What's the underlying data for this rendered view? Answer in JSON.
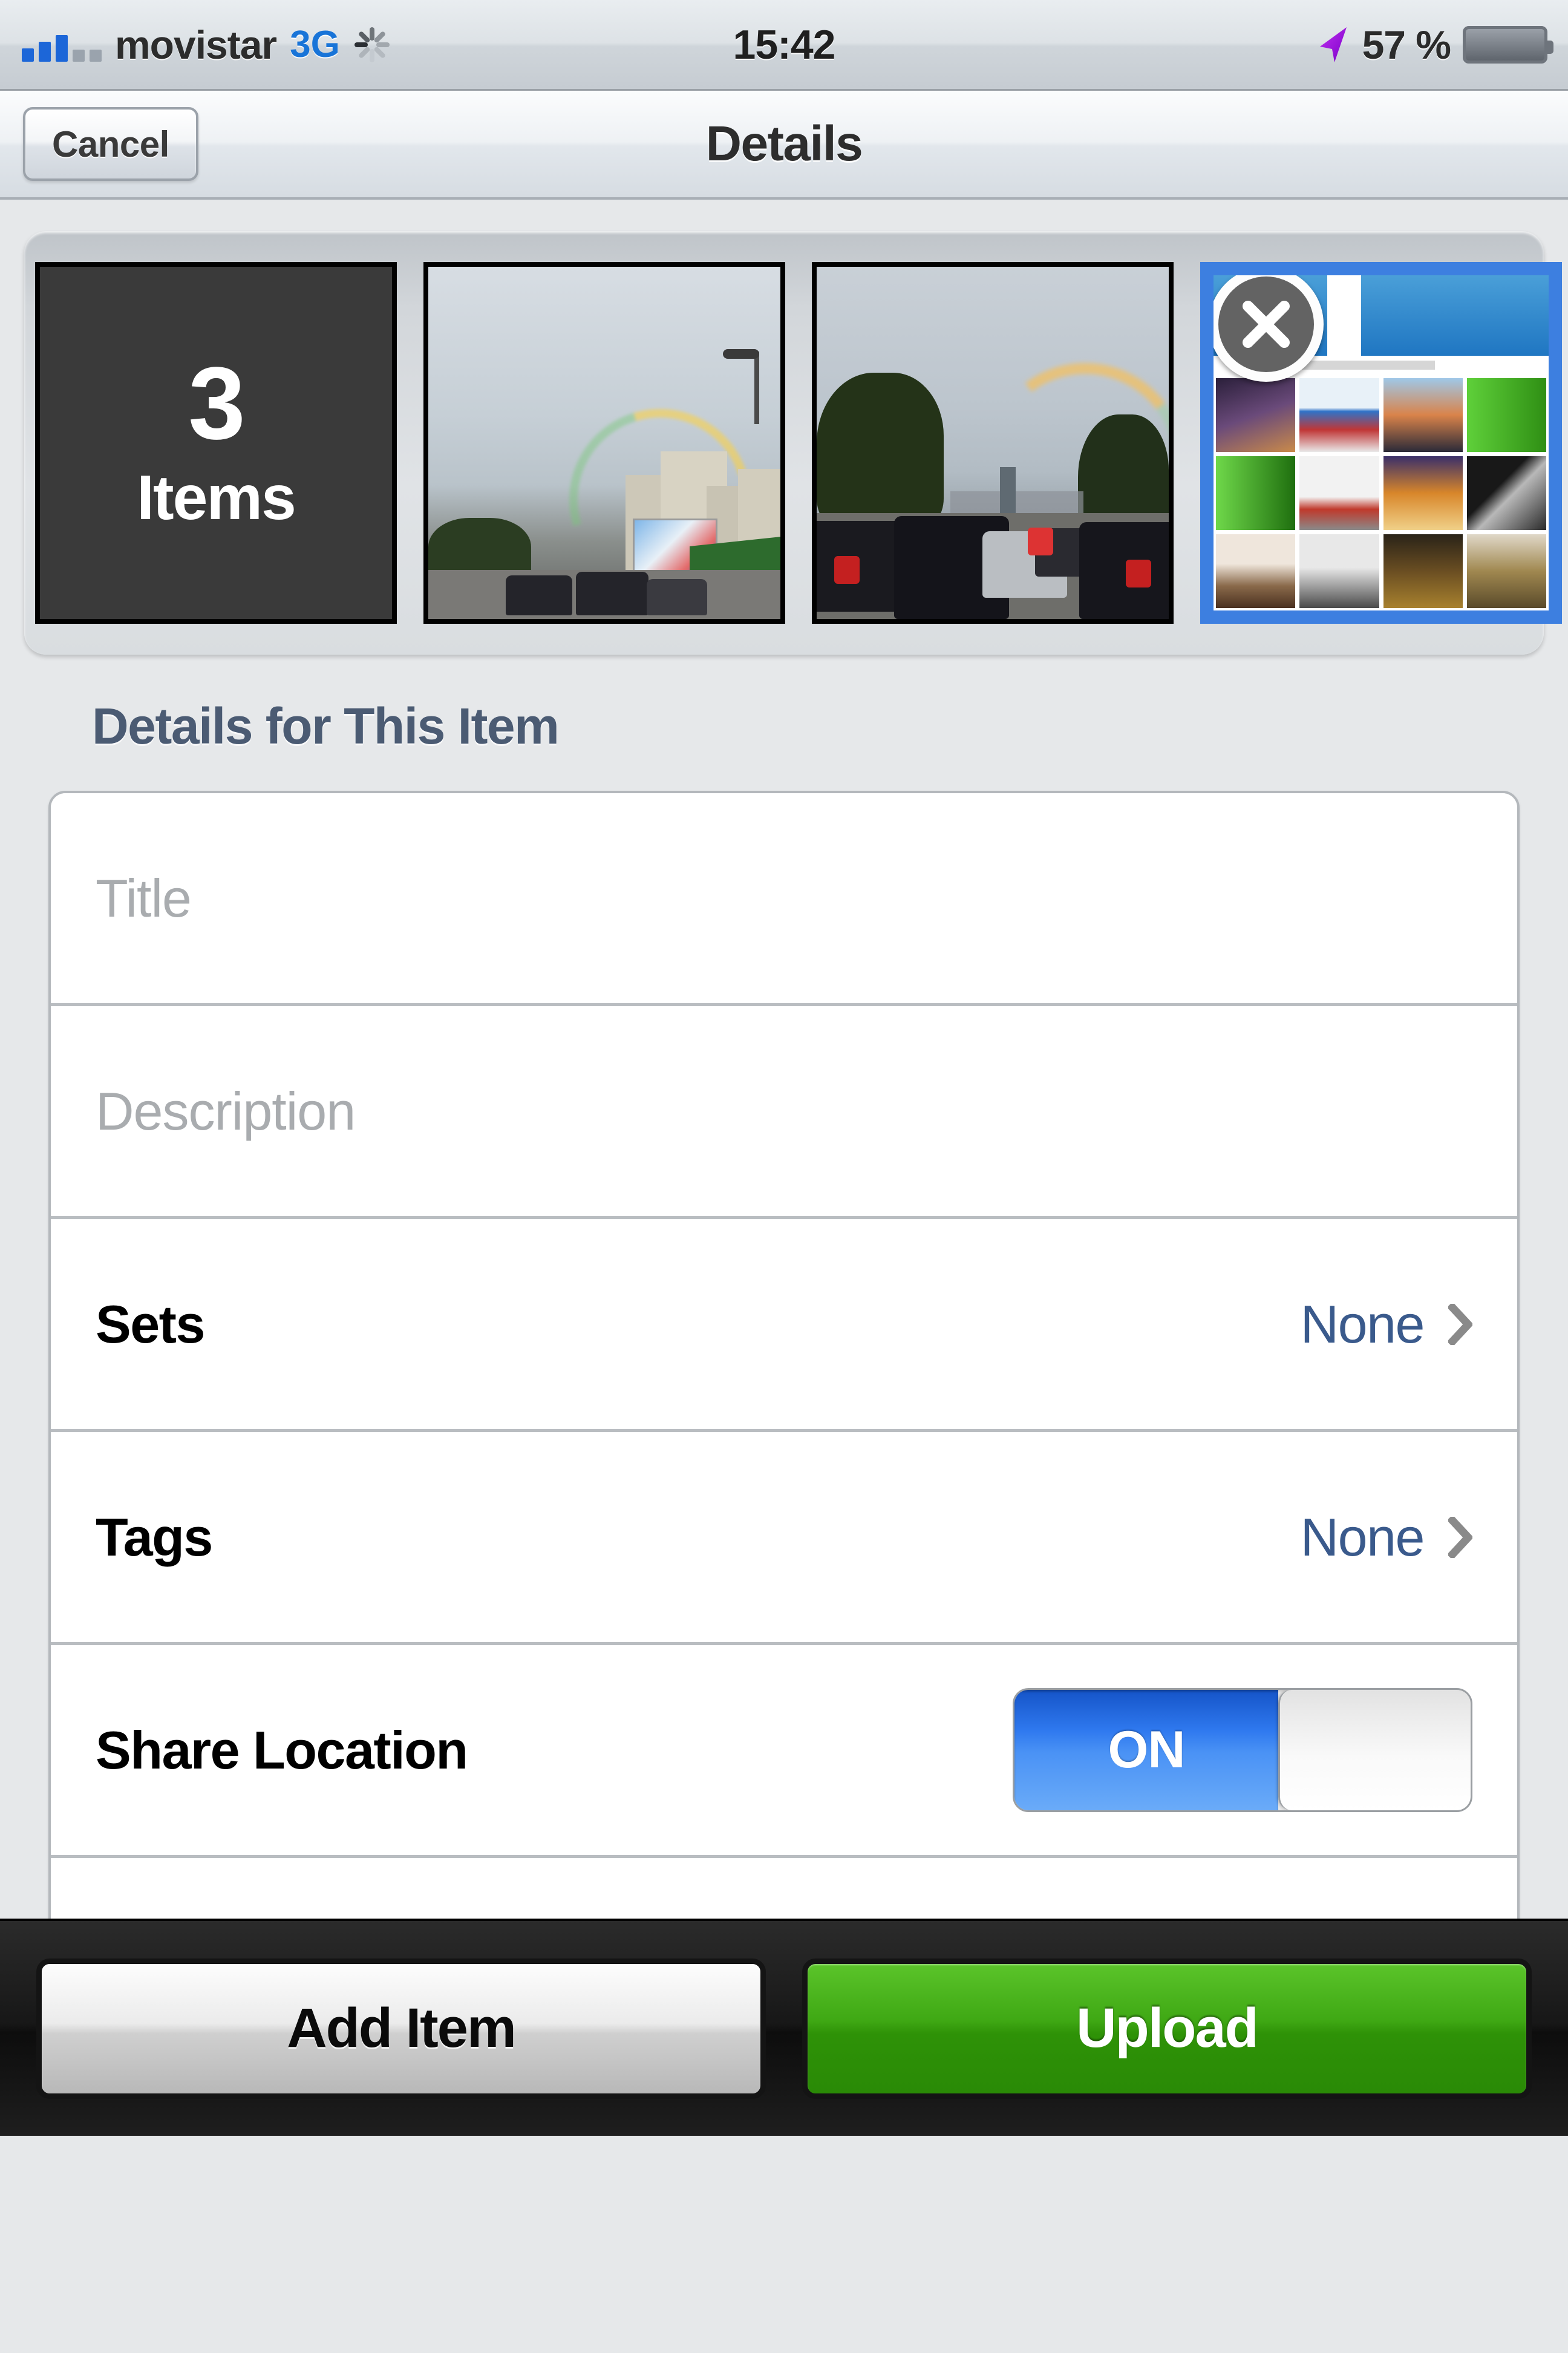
{
  "status_bar": {
    "carrier": "movistar",
    "network": "3G",
    "clock": "15:42",
    "battery_percent": "57 %",
    "battery_level": 57,
    "signal_bars_active": 3,
    "signal_bars_total": 5,
    "icons": [
      "signal-bars-icon",
      "activity-spinner-icon",
      "location-arrow-icon",
      "battery-icon"
    ]
  },
  "nav_bar": {
    "cancel_label": "Cancel",
    "title": "Details"
  },
  "thumbnail_strip": {
    "counter": {
      "count": "3",
      "label": "Items"
    },
    "items": [
      {
        "name": "city-street-rainbow",
        "selected": false
      },
      {
        "name": "highway-traffic-rainbow",
        "selected": false
      },
      {
        "name": "photo-grid-screenshot",
        "selected": true,
        "delete_icon": "close-x-icon"
      }
    ]
  },
  "section": {
    "header": "Details for This Item"
  },
  "form": {
    "title_field": {
      "label": "Title",
      "placeholder": "Title",
      "value": ""
    },
    "description_field": {
      "label": "Description",
      "placeholder": "Description",
      "value": ""
    },
    "sets_row": {
      "label": "Sets",
      "value": "None",
      "chevron": "chevron-right-icon"
    },
    "tags_row": {
      "label": "Tags",
      "value": "None",
      "chevron": "chevron-right-icon"
    },
    "share_location_row": {
      "label": "Share Location",
      "toggle_state": "ON",
      "toggle_on": true
    },
    "partial_row": {
      "label": "",
      "value": ""
    }
  },
  "toolbar": {
    "add_item_label": "Add Item",
    "upload_label": "Upload"
  },
  "colors": {
    "accent_blue": "#3d7fe0",
    "toggle_blue": "#2f79ef",
    "link_blue": "#3a5a8c",
    "section_header": "#4b5b73",
    "upload_green": "#3fa814",
    "page_background": "#e6e8ea",
    "carrier_3g": "#1874d8",
    "location_purple": "#a020d8"
  }
}
